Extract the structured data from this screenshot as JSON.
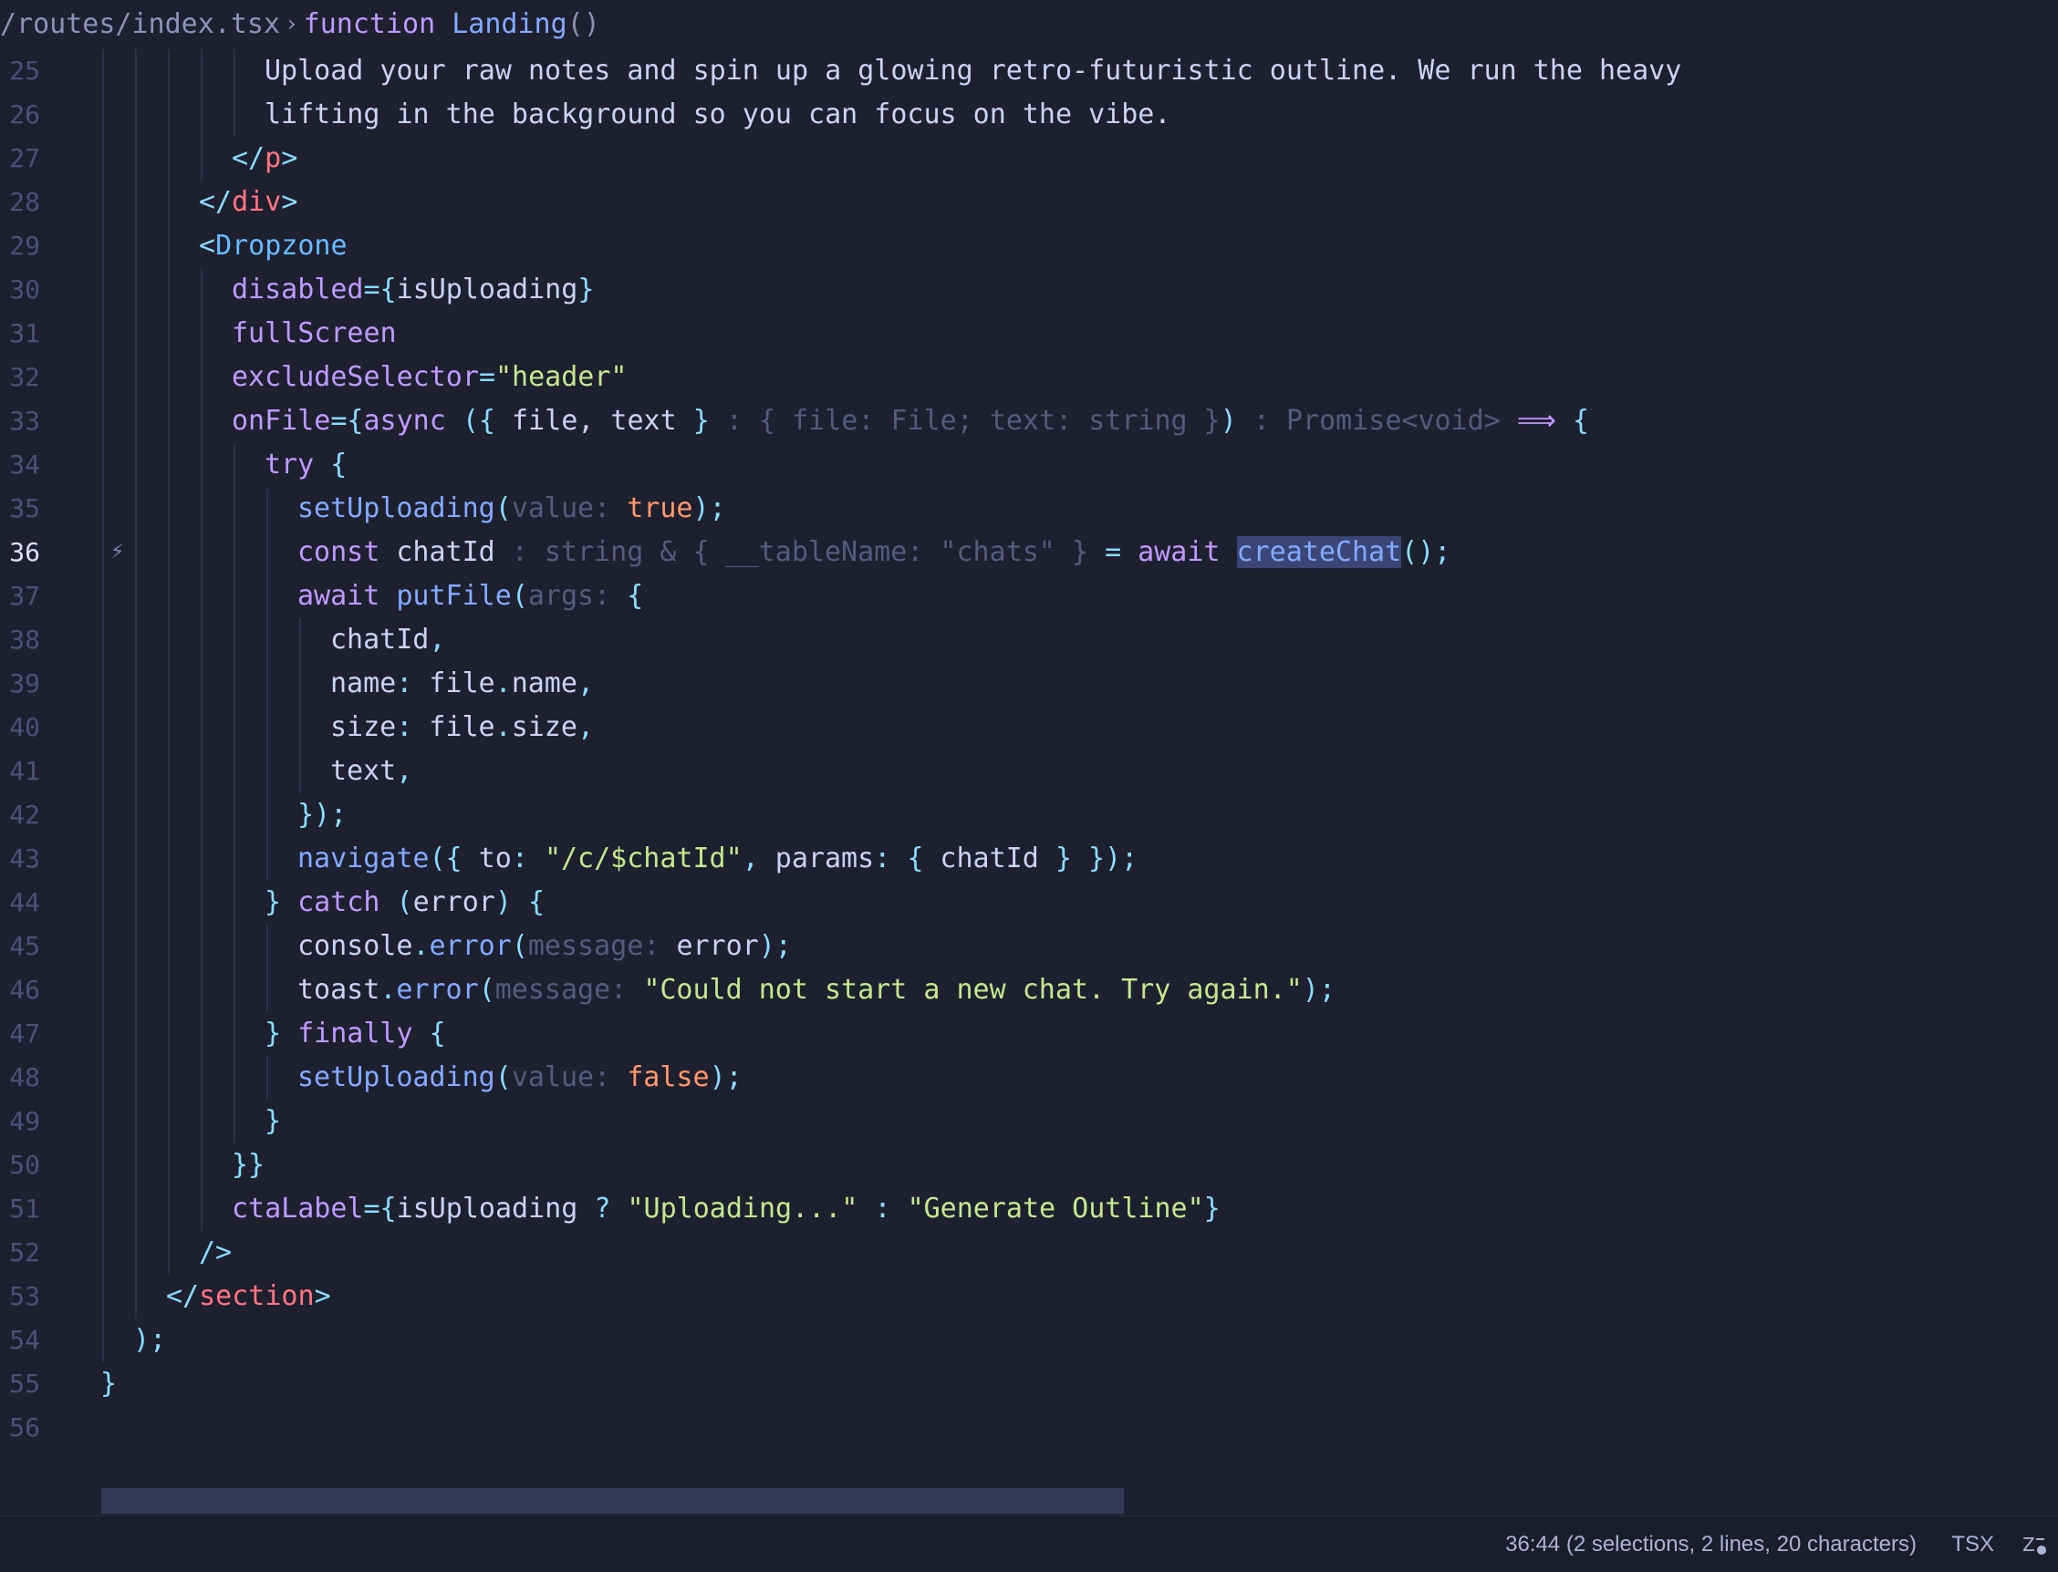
{
  "breadcrumb": {
    "path": "/routes/index.tsx",
    "separator": "›",
    "keyword": "function",
    "function_name": "Landing",
    "parens": "()"
  },
  "editor": {
    "active_line": 36,
    "lines": [
      {
        "n": 25,
        "indent": 5,
        "tokens": [
          [
            "t-text",
            "Upload your raw notes and spin up a glowing retro-futuristic outline. We run the heavy"
          ]
        ]
      },
      {
        "n": 26,
        "indent": 5,
        "tokens": [
          [
            "t-text",
            "lifting in the background so you can focus on the vibe."
          ]
        ]
      },
      {
        "n": 27,
        "indent": 4,
        "tokens": [
          [
            "t-punc",
            "</"
          ],
          [
            "t-tag",
            "p"
          ],
          [
            "t-punc",
            ">"
          ]
        ]
      },
      {
        "n": 28,
        "indent": 3,
        "tokens": [
          [
            "t-punc",
            "</"
          ],
          [
            "t-tag",
            "div"
          ],
          [
            "t-punc",
            ">"
          ]
        ]
      },
      {
        "n": 29,
        "indent": 3,
        "tokens": [
          [
            "t-punc",
            "<"
          ],
          [
            "t-comp",
            "Dropzone"
          ]
        ]
      },
      {
        "n": 30,
        "indent": 4,
        "tokens": [
          [
            "t-attr",
            "disabled"
          ],
          [
            "t-punc",
            "={"
          ],
          [
            "t-var",
            "isUploading"
          ],
          [
            "t-punc",
            "}"
          ]
        ]
      },
      {
        "n": 31,
        "indent": 4,
        "tokens": [
          [
            "t-attr",
            "fullScreen"
          ]
        ]
      },
      {
        "n": 32,
        "indent": 4,
        "tokens": [
          [
            "t-attr",
            "excludeSelector"
          ],
          [
            "t-punc",
            "="
          ],
          [
            "t-str",
            "\"header\""
          ]
        ]
      },
      {
        "n": 33,
        "indent": 4,
        "tokens": [
          [
            "t-attr",
            "onFile"
          ],
          [
            "t-punc",
            "={"
          ],
          [
            "t-kw",
            "async"
          ],
          [
            "t-text",
            " "
          ],
          [
            "t-punc",
            "({"
          ],
          [
            "t-text",
            " file, text "
          ],
          [
            "t-punc",
            "}"
          ],
          [
            "t-hint",
            " : { file: File; text: string }"
          ],
          [
            "t-punc",
            ")"
          ],
          [
            "t-hint",
            " : Promise<void>"
          ],
          [
            "t-text",
            " "
          ],
          [
            "t-kw",
            "⟹"
          ],
          [
            "t-text",
            " "
          ],
          [
            "t-punc",
            "{"
          ]
        ]
      },
      {
        "n": 34,
        "indent": 5,
        "tokens": [
          [
            "t-kw",
            "try"
          ],
          [
            "t-text",
            " "
          ],
          [
            "t-punc",
            "{"
          ]
        ]
      },
      {
        "n": 35,
        "indent": 6,
        "tokens": [
          [
            "t-fn",
            "setUploading"
          ],
          [
            "t-punc",
            "("
          ],
          [
            "t-hint",
            "value: "
          ],
          [
            "t-bool",
            "true"
          ],
          [
            "t-punc",
            ");"
          ]
        ]
      },
      {
        "n": 36,
        "indent": 6,
        "tokens": [
          [
            "t-kw",
            "const"
          ],
          [
            "t-text",
            " chatId"
          ],
          [
            "t-hint",
            " : string & { __tableName: \"chats\" }"
          ],
          [
            "t-text",
            " "
          ],
          [
            "t-punc",
            "="
          ],
          [
            "t-text",
            " "
          ],
          [
            "t-kw",
            "await"
          ],
          [
            "t-text",
            " "
          ],
          [
            "t-fn t-sel",
            "createChat"
          ],
          [
            "t-punc",
            "();"
          ]
        ]
      },
      {
        "n": 37,
        "indent": 6,
        "tokens": [
          [
            "t-kw",
            "await"
          ],
          [
            "t-text",
            " "
          ],
          [
            "t-fn",
            "putFile"
          ],
          [
            "t-punc",
            "("
          ],
          [
            "t-hint",
            "args: "
          ],
          [
            "t-punc",
            "{"
          ]
        ]
      },
      {
        "n": 38,
        "indent": 7,
        "tokens": [
          [
            "t-text",
            "chatId"
          ],
          [
            "t-punc",
            ","
          ]
        ]
      },
      {
        "n": 39,
        "indent": 7,
        "tokens": [
          [
            "t-text",
            "name"
          ],
          [
            "t-punc",
            ":"
          ],
          [
            "t-text",
            " file"
          ],
          [
            "t-punc",
            "."
          ],
          [
            "t-text",
            "name"
          ],
          [
            "t-punc",
            ","
          ]
        ]
      },
      {
        "n": 40,
        "indent": 7,
        "tokens": [
          [
            "t-text",
            "size"
          ],
          [
            "t-punc",
            ":"
          ],
          [
            "t-text",
            " file"
          ],
          [
            "t-punc",
            "."
          ],
          [
            "t-text",
            "size"
          ],
          [
            "t-punc",
            ","
          ]
        ]
      },
      {
        "n": 41,
        "indent": 7,
        "tokens": [
          [
            "t-text",
            "text"
          ],
          [
            "t-punc",
            ","
          ]
        ]
      },
      {
        "n": 42,
        "indent": 6,
        "tokens": [
          [
            "t-punc",
            "});"
          ]
        ]
      },
      {
        "n": 43,
        "indent": 6,
        "tokens": [
          [
            "t-fn",
            "navigate"
          ],
          [
            "t-punc",
            "({"
          ],
          [
            "t-text",
            " to"
          ],
          [
            "t-punc",
            ":"
          ],
          [
            "t-text",
            " "
          ],
          [
            "t-str",
            "\"/c/$chatId\""
          ],
          [
            "t-punc",
            ","
          ],
          [
            "t-text",
            " params"
          ],
          [
            "t-punc",
            ":"
          ],
          [
            "t-text",
            " "
          ],
          [
            "t-punc",
            "{"
          ],
          [
            "t-text",
            " chatId "
          ],
          [
            "t-punc",
            "} });"
          ]
        ]
      },
      {
        "n": 44,
        "indent": 5,
        "tokens": [
          [
            "t-punc",
            "}"
          ],
          [
            "t-text",
            " "
          ],
          [
            "t-kw",
            "catch"
          ],
          [
            "t-text",
            " "
          ],
          [
            "t-punc",
            "("
          ],
          [
            "t-text",
            "error"
          ],
          [
            "t-punc",
            ")"
          ],
          [
            "t-text",
            " "
          ],
          [
            "t-punc",
            "{"
          ]
        ]
      },
      {
        "n": 45,
        "indent": 6,
        "tokens": [
          [
            "t-text",
            "console"
          ],
          [
            "t-punc",
            "."
          ],
          [
            "t-fn",
            "error"
          ],
          [
            "t-punc",
            "("
          ],
          [
            "t-hint",
            "message: "
          ],
          [
            "t-text",
            "error"
          ],
          [
            "t-punc",
            ");"
          ]
        ]
      },
      {
        "n": 46,
        "indent": 6,
        "tokens": [
          [
            "t-text",
            "toast"
          ],
          [
            "t-punc",
            "."
          ],
          [
            "t-fn",
            "error"
          ],
          [
            "t-punc",
            "("
          ],
          [
            "t-hint",
            "message: "
          ],
          [
            "t-str",
            "\"Could not start a new chat. Try again.\""
          ],
          [
            "t-punc",
            ");"
          ]
        ]
      },
      {
        "n": 47,
        "indent": 5,
        "tokens": [
          [
            "t-punc",
            "}"
          ],
          [
            "t-text",
            " "
          ],
          [
            "t-kw",
            "finally"
          ],
          [
            "t-text",
            " "
          ],
          [
            "t-punc",
            "{"
          ]
        ]
      },
      {
        "n": 48,
        "indent": 6,
        "tokens": [
          [
            "t-fn",
            "setUploading"
          ],
          [
            "t-punc",
            "("
          ],
          [
            "t-hint",
            "value: "
          ],
          [
            "t-bool",
            "false"
          ],
          [
            "t-punc",
            ");"
          ]
        ]
      },
      {
        "n": 49,
        "indent": 5,
        "tokens": [
          [
            "t-punc",
            "}"
          ]
        ]
      },
      {
        "n": 50,
        "indent": 4,
        "tokens": [
          [
            "t-punc",
            "}}"
          ]
        ]
      },
      {
        "n": 51,
        "indent": 4,
        "tokens": [
          [
            "t-attr",
            "ctaLabel"
          ],
          [
            "t-punc",
            "={"
          ],
          [
            "t-var",
            "isUploading"
          ],
          [
            "t-text",
            " "
          ],
          [
            "t-punc",
            "?"
          ],
          [
            "t-text",
            " "
          ],
          [
            "t-str",
            "\"Uploading...\""
          ],
          [
            "t-text",
            " "
          ],
          [
            "t-punc",
            ":"
          ],
          [
            "t-text",
            " "
          ],
          [
            "t-str",
            "\"Generate Outline\""
          ],
          [
            "t-punc",
            "}"
          ]
        ]
      },
      {
        "n": 52,
        "indent": 3,
        "tokens": [
          [
            "t-punc",
            "/>"
          ]
        ]
      },
      {
        "n": 53,
        "indent": 2,
        "tokens": [
          [
            "t-punc",
            "</"
          ],
          [
            "t-tag",
            "section"
          ],
          [
            "t-punc",
            ">"
          ]
        ]
      },
      {
        "n": 54,
        "indent": 1,
        "tokens": [
          [
            "t-punc",
            ");"
          ]
        ]
      },
      {
        "n": 55,
        "indent": 0,
        "tokens": [
          [
            "t-punc",
            "}"
          ]
        ]
      },
      {
        "n": 56,
        "indent": 0,
        "tokens": []
      }
    ]
  },
  "statusbar": {
    "cursor": "36:44 (2 selections, 2 lines, 20 characters)",
    "language": "TSX",
    "icon": "ai-sparkle-icon"
  }
}
